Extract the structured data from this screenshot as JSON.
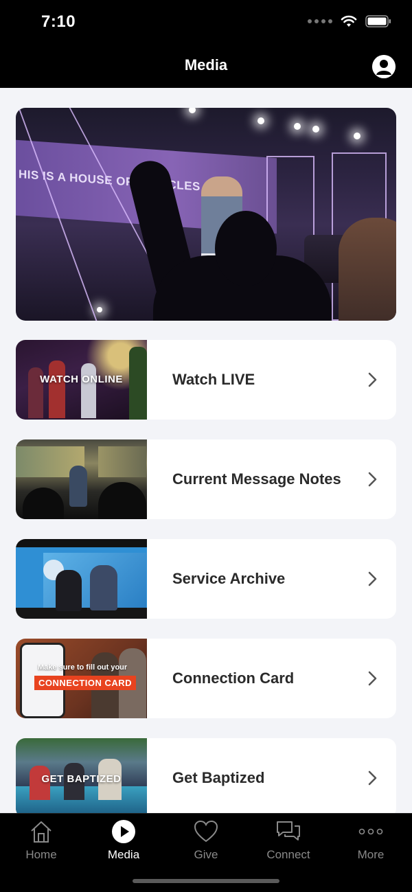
{
  "status": {
    "time": "7:10"
  },
  "header": {
    "title": "Media"
  },
  "hero": {
    "screen_text": "HIS IS A HOUSE OF MIRACLES"
  },
  "cards": [
    {
      "label": "Watch LIVE",
      "thumb_text": "WATCH ONLINE"
    },
    {
      "label": "Current Message Notes"
    },
    {
      "label": "Service Archive"
    },
    {
      "label": "Connection Card",
      "thumb_caption": "Make sure to fill out your",
      "thumb_badge": "CONNECTION CARD"
    },
    {
      "label": "Get Baptized",
      "thumb_text": "GET BAPTIZED"
    }
  ],
  "tabs": [
    {
      "label": "Home",
      "icon": "home-icon"
    },
    {
      "label": "Media",
      "icon": "play-icon",
      "active": true
    },
    {
      "label": "Give",
      "icon": "heart-icon"
    },
    {
      "label": "Connect",
      "icon": "chat-icon"
    },
    {
      "label": "More",
      "icon": "more-icon"
    }
  ],
  "colors": {
    "background": "#f3f4f8",
    "bar": "#000000",
    "accent": "#e8431f"
  }
}
